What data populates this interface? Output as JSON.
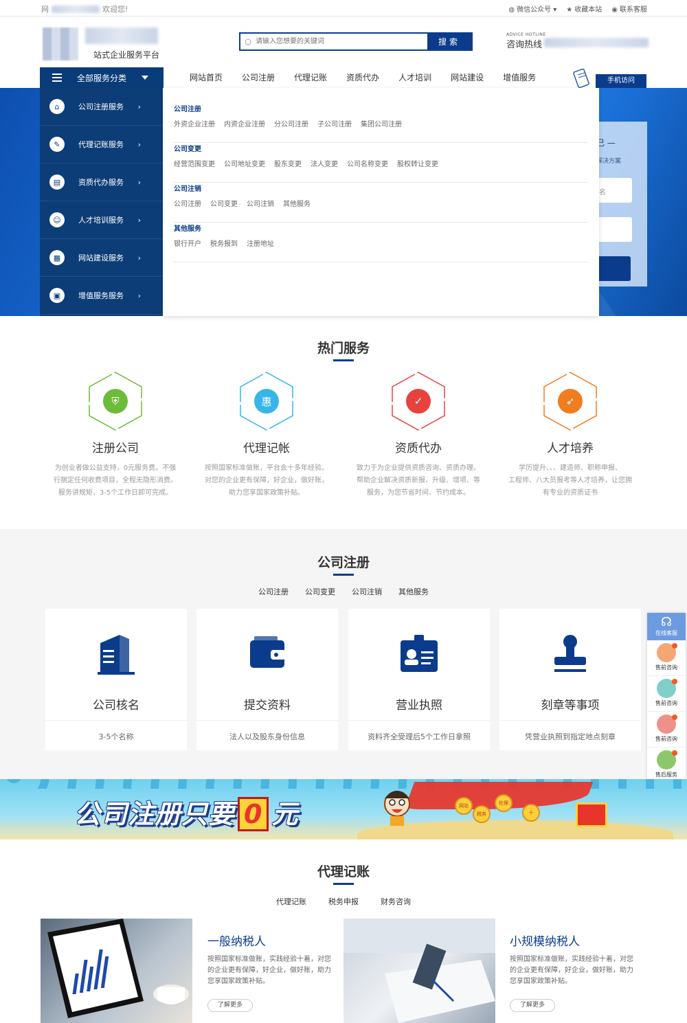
{
  "topbar": {
    "left_prefix": "网",
    "left_suffix": "欢迎您!",
    "links": [
      {
        "label": "微信公众号",
        "icon": "wechat-icon"
      },
      {
        "label": "收藏本站",
        "icon": "star-icon"
      },
      {
        "label": "联系客服",
        "icon": "service-icon"
      }
    ]
  },
  "header": {
    "slogan": "站式企业服务平台",
    "search_placeholder": "请输入您想要的关键词",
    "search_button": "搜索",
    "hotline_en": "ADVICE HOTLINE",
    "hotline_cn": "咨询热线"
  },
  "nav": {
    "category_label": "全部服务分类",
    "links": [
      "网站首页",
      "公司注册",
      "代理记账",
      "资质代办",
      "人才培训",
      "网站建设",
      "增值服务"
    ],
    "mobile_label": "手机访问"
  },
  "side_menu": [
    {
      "label": "公司注册服务",
      "icon": "company-register-icon",
      "glyph": "⌂"
    },
    {
      "label": "代理记账服务",
      "icon": "pencil-icon",
      "glyph": "✎"
    },
    {
      "label": "资质代办服务",
      "icon": "certificate-icon",
      "glyph": "▤"
    },
    {
      "label": "人才培训服务",
      "icon": "person-icon",
      "glyph": "☺"
    },
    {
      "label": "网站建设服务",
      "icon": "browser-icon",
      "glyph": "▦"
    },
    {
      "label": "增值服务服务",
      "icon": "apps-icon",
      "glyph": "▣"
    }
  ],
  "dropdown": [
    {
      "heading": "公司注册",
      "links": [
        "外资企业注册",
        "内资企业注册",
        "分公司注册",
        "子公司注册",
        "集团公司注册"
      ]
    },
    {
      "heading": "公司变更",
      "links": [
        "经营范围变更",
        "公司地址变更",
        "股东变更",
        "法人变更",
        "公司名称变更",
        "股权转让变更"
      ]
    },
    {
      "heading": "公司注销",
      "links": [
        "公司注册",
        "公司变更",
        "公司注销",
        "其他服务"
      ]
    },
    {
      "heading": "其他服务",
      "links": [
        "银行开户",
        "税务报到",
        "注册地址"
      ]
    }
  ],
  "hero_card": {
    "title": "己 —",
    "subtitle": "解决方案",
    "input1": "名"
  },
  "hot": {
    "title": "热门服务",
    "items": [
      {
        "name": "注册公司",
        "icon": "shield-icon",
        "color": "#6dbb3a",
        "glyph": "⛨",
        "desc": [
          "为创业者做公益支持，0元服务费。不强",
          "行捆定任何收费项目，全程无隐形消费。",
          "服务讲规矩，3-5个工作日即可完成。"
        ]
      },
      {
        "name": "代理记帐",
        "icon": "ticket-icon",
        "color": "#37b5e8",
        "glyph": "惠",
        "desc": [
          "按照国家标准做账，平台会十多年经验。",
          "对您的企业更有保障，好企业，做好账，",
          "助力您享国家政策补贴。"
        ]
      },
      {
        "name": "资质代办",
        "icon": "badge-icon",
        "color": "#e8423e",
        "glyph": "✓",
        "desc": [
          "致力于为企业提供资质咨询、资质办理。",
          "帮助企业解决资质新报、升级、增项、等",
          "服务，为您节省时间、节约成本。"
        ]
      },
      {
        "name": "人才培养",
        "icon": "rocket-icon",
        "color": "#f07d20",
        "glyph": "➶",
        "desc": [
          "学历提升、、、建造师、职称申报、",
          "工程师、八大员报考等人才培养，让您拥",
          "有专业的资质证书"
        ]
      }
    ]
  },
  "register": {
    "title": "公司注册",
    "tabs": [
      "公司注册",
      "公司变更",
      "公司注销",
      "其他服务"
    ],
    "cards": [
      {
        "name": "公司核名",
        "icon": "building-icon",
        "desc": "3-5个名称"
      },
      {
        "name": "提交资料",
        "icon": "wallet-icon",
        "desc": "法人以及股东身份信息"
      },
      {
        "name": "营业执照",
        "icon": "id-card-icon",
        "desc": "资料齐全受理后5个工作日拿照"
      },
      {
        "name": "刻章等事项",
        "icon": "stamp-icon",
        "desc": "凭营业执照到指定地点刻章"
      }
    ]
  },
  "float_bar": {
    "top_label": "在线客服",
    "items": [
      {
        "label": "售前咨询",
        "color": "#f3a774"
      },
      {
        "label": "售前咨询",
        "color": "#7fd0c8"
      },
      {
        "label": "售前咨询",
        "color": "#f0908a"
      },
      {
        "label": "售后服务",
        "color": "#8cc86a"
      }
    ]
  },
  "banner": {
    "text_before": "公司注册只要",
    "zero": "0",
    "text_after": "元",
    "coins": [
      "网站",
      "税务",
      "社保",
      "十"
    ]
  },
  "accounting": {
    "title": "代理记账",
    "tabs": [
      "代理记账",
      "税务申报",
      "财务咨询"
    ],
    "items": [
      {
        "title": "一般纳税人",
        "desc": "按照国家标准做账，实践经验十着，对您的企业更有保障，好企业，做好账，助力您享国家政策补贴。",
        "button": "了解更多"
      },
      {
        "title": "小规模纳税人",
        "desc": "按照国家标准做账，实践经验十着，对您的企业更有保障，好企业，做好账，助力您享国家政策补贴。",
        "button": "了解更多"
      }
    ]
  }
}
